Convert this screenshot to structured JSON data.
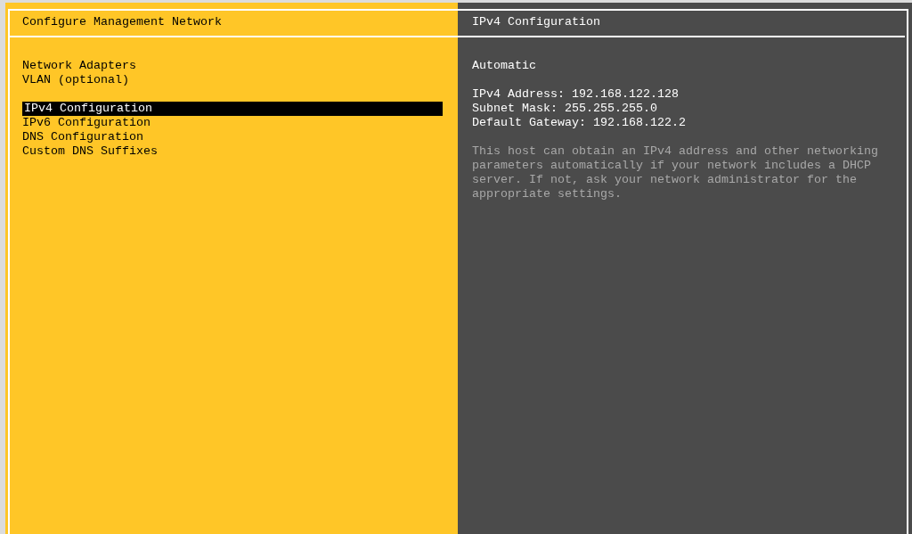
{
  "left_panel": {
    "title": "Configure Management Network",
    "menu_groups": [
      [
        {
          "label": "Network Adapters",
          "selected": false
        },
        {
          "label": "VLAN (optional)",
          "selected": false
        }
      ],
      [
        {
          "label": "IPv4 Configuration",
          "selected": true
        },
        {
          "label": "IPv6 Configuration",
          "selected": false
        },
        {
          "label": "DNS Configuration",
          "selected": false
        },
        {
          "label": "Custom DNS Suffixes",
          "selected": false
        }
      ]
    ]
  },
  "right_panel": {
    "title": "IPv4 Configuration",
    "mode": "Automatic",
    "details": [
      "IPv4 Address: 192.168.122.128",
      "Subnet Mask: 255.255.255.0",
      "Default Gateway: 192.168.122.2"
    ],
    "description": "This host can obtain an IPv4 address and other networking parameters automatically if your network includes a DHCP server. If not, ask your network administrator for the appropriate settings."
  }
}
